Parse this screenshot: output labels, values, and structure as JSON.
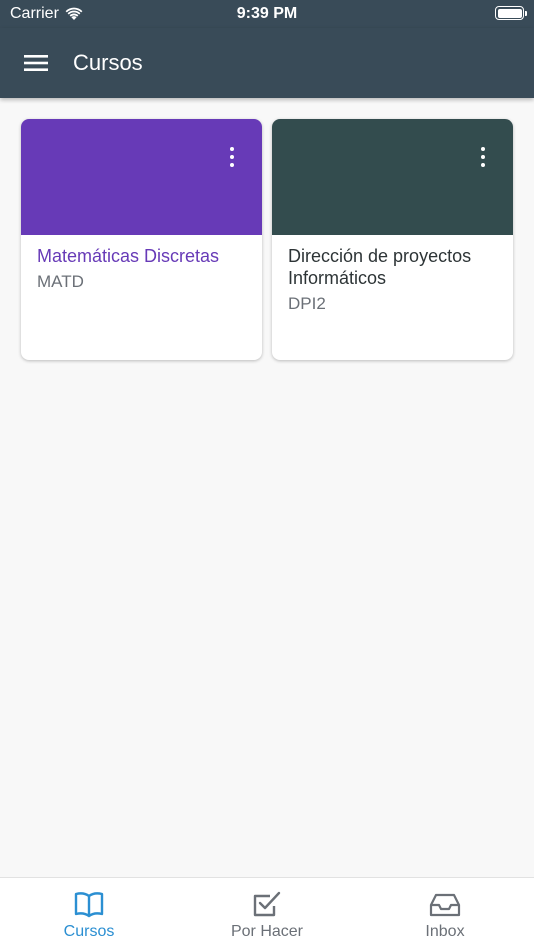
{
  "status_bar": {
    "carrier": "Carrier",
    "time": "9:39 PM"
  },
  "app_bar": {
    "title": "Cursos",
    "menu_icon": "hamburger-menu-icon"
  },
  "courses": [
    {
      "name": "Matemáticas Discretas",
      "code": "MATD",
      "color": "#673ab7",
      "name_color": "#673ab7"
    },
    {
      "name": "Dirección de proyectos Informáticos",
      "code": "DPI2",
      "color": "#334c4e",
      "name_color": "#2d3436"
    }
  ],
  "tabs": [
    {
      "label": "Cursos",
      "icon": "open-book-icon",
      "active": true
    },
    {
      "label": "Por Hacer",
      "icon": "checkbox-icon",
      "active": false
    },
    {
      "label": "Inbox",
      "icon": "inbox-tray-icon",
      "active": false
    }
  ],
  "colors": {
    "app_bar": "#394b58",
    "tab_active": "#2b8fd2",
    "tab_inactive": "#6b7077",
    "background": "#f8f8f8"
  }
}
